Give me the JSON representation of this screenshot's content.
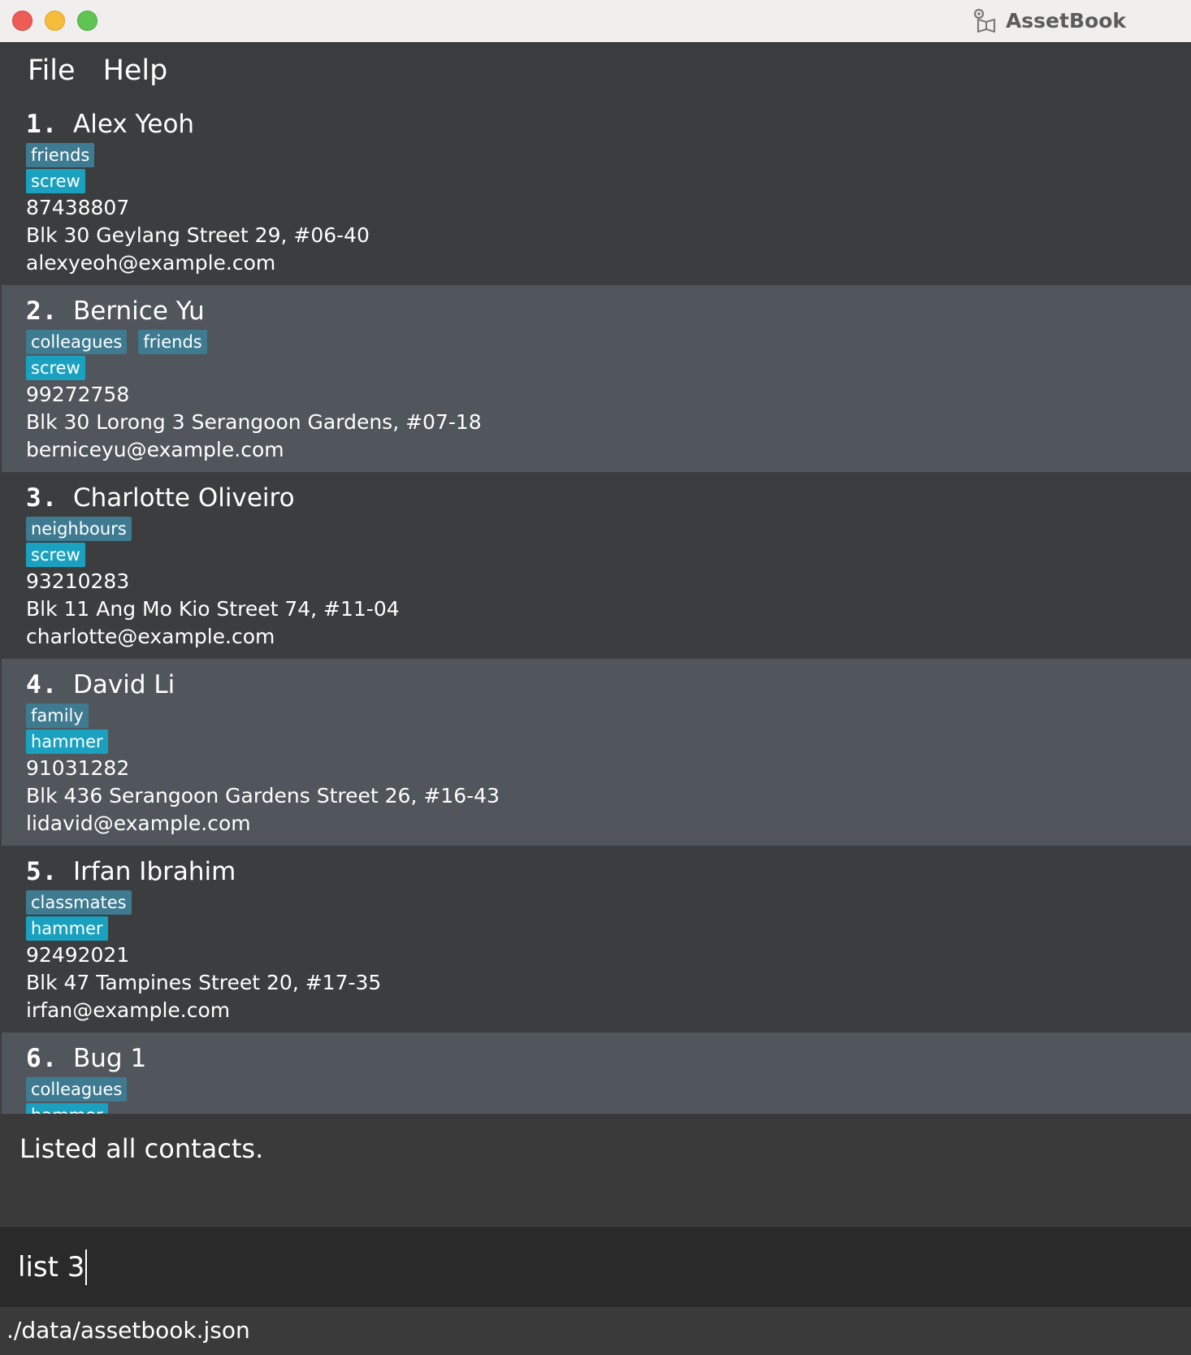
{
  "window": {
    "title": "AssetBook"
  },
  "menu": {
    "file": "File",
    "help": "Help"
  },
  "contacts": [
    {
      "index": "1.",
      "name": "Alex Yeoh",
      "tag_rows": [
        [
          {
            "label": "friends",
            "kind": "group"
          }
        ],
        [
          {
            "label": "screw",
            "kind": "item"
          }
        ]
      ],
      "phone": "87438807",
      "address": "Blk 30 Geylang Street 29, #06-40",
      "email": "alexyeoh@example.com"
    },
    {
      "index": "2.",
      "name": "Bernice Yu",
      "tag_rows": [
        [
          {
            "label": "colleagues",
            "kind": "group"
          },
          {
            "label": "friends",
            "kind": "group"
          }
        ],
        [
          {
            "label": "screw",
            "kind": "item"
          }
        ]
      ],
      "phone": "99272758",
      "address": "Blk 30 Lorong 3 Serangoon Gardens, #07-18",
      "email": "berniceyu@example.com"
    },
    {
      "index": "3.",
      "name": "Charlotte Oliveiro",
      "tag_rows": [
        [
          {
            "label": "neighbours",
            "kind": "group"
          }
        ],
        [
          {
            "label": "screw",
            "kind": "item"
          }
        ]
      ],
      "phone": "93210283",
      "address": "Blk 11 Ang Mo Kio Street 74, #11-04",
      "email": "charlotte@example.com"
    },
    {
      "index": "4.",
      "name": "David Li",
      "tag_rows": [
        [
          {
            "label": "family",
            "kind": "group"
          }
        ],
        [
          {
            "label": "hammer",
            "kind": "item"
          }
        ]
      ],
      "phone": "91031282",
      "address": "Blk 436 Serangoon Gardens Street 26, #16-43",
      "email": "lidavid@example.com"
    },
    {
      "index": "5.",
      "name": "Irfan Ibrahim",
      "tag_rows": [
        [
          {
            "label": "classmates",
            "kind": "group"
          }
        ],
        [
          {
            "label": "hammer",
            "kind": "item"
          }
        ]
      ],
      "phone": "92492021",
      "address": "Blk 47 Tampines Street 20, #17-35",
      "email": "irfan@example.com"
    },
    {
      "index": "6.",
      "name": "Bug 1",
      "tag_rows": [
        [
          {
            "label": "colleagues",
            "kind": "group"
          }
        ],
        [
          {
            "label": "hammer",
            "kind": "item"
          }
        ]
      ],
      "phone": "",
      "address": "",
      "email": ""
    }
  ],
  "result_message": "Listed all contacts.",
  "command": {
    "value": "list 3"
  },
  "status": {
    "path": "./data/assetbook.json"
  },
  "colors": {
    "group_tag": "#3e7b91",
    "item_tag": "#1ba1c0",
    "card_dark": "#3c3d3f",
    "card_light": "#50565b"
  }
}
